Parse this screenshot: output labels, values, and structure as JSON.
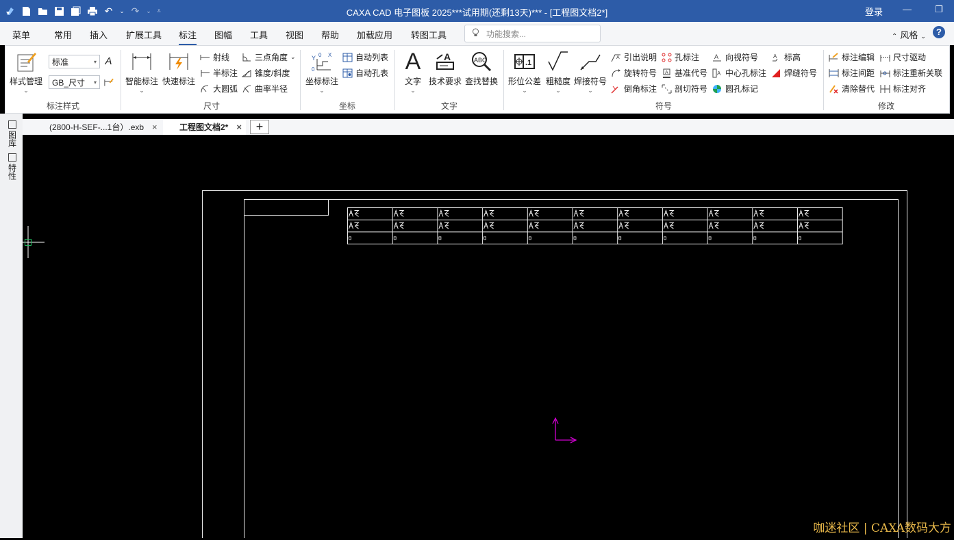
{
  "titlebar": {
    "title": "CAXA CAD 电子图板 2025***试用期(还剩13天)*** - [工程图文档2*]",
    "login": "登录"
  },
  "menu": {
    "items": [
      {
        "label": "菜单"
      },
      {
        "label": "常用"
      },
      {
        "label": "插入"
      },
      {
        "label": "扩展工具"
      },
      {
        "label": "标注"
      },
      {
        "label": "图幅"
      },
      {
        "label": "工具"
      },
      {
        "label": "视图"
      },
      {
        "label": "帮助"
      },
      {
        "label": "加载应用"
      },
      {
        "label": "转图工具"
      }
    ],
    "active": "标注",
    "search_placeholder": "功能搜索...",
    "style_label": "风格"
  },
  "ribbon": {
    "groups": {
      "style": "标注样式",
      "dimension": "尺寸",
      "coordinate": "坐标",
      "text": "文字",
      "symbol": "符号",
      "modify": "修改"
    },
    "style_manager": "样式管理",
    "combo_standard": "标准",
    "combo_gb": "GB_尺寸",
    "smart_dim": "智能标注",
    "quick_dim": "快速标注",
    "ray": "射线",
    "half_dim": "半标注",
    "big_arc": "大圆弧",
    "three_point_angle": "三点角度",
    "taper_slope": "锥度/斜度",
    "curve_radius": "曲率半径",
    "coord_dim": "坐标标注",
    "auto_list": "自动列表",
    "auto_hole": "自动孔表",
    "text": "文字",
    "tech_req": "技术要求",
    "find_replace": "查找替换",
    "geo_tol": "形位公差",
    "roughness": "粗糙度",
    "weld_symbol": "焊接符号",
    "leader": "引出说明",
    "rotate_symbol": "旋转符号",
    "chamfer_dim": "倒角标注",
    "hole_dim": "孔标注",
    "datum_code": "基准代号",
    "section_symbol": "剖切符号",
    "view_symbol": "向视符号",
    "center_hole": "中心孔标注",
    "round_hole_mark": "圆孔标记",
    "elevation": "标高",
    "weld_seam": "焊缝符号",
    "dim_edit": "标注编辑",
    "dim_spacing": "标注间距",
    "clear_override": "清除替代",
    "dim_drive": "尺寸驱动",
    "dim_reassoc": "标注重新关联",
    "dim_align": "标注对齐"
  },
  "tabs": [
    {
      "label": "(2800-H-SEF-...1台）.exb"
    },
    {
      "label": "工程图文档2*"
    }
  ],
  "side_tabs": {
    "library": "图库",
    "properties": "特性"
  },
  "drawing": {
    "table_rows": 3,
    "table_cols": 11
  },
  "watermark": "咖迷社区 | CAXA数码大方",
  "colors": {
    "titlebar": "#2d5ca8",
    "ucs": "#d000d0",
    "crosshair_box": "#20c060"
  }
}
